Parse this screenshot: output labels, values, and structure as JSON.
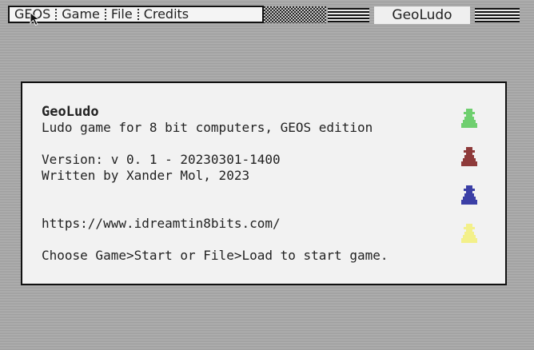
{
  "menu": {
    "items": [
      {
        "label": "GEOS"
      },
      {
        "label": "Game"
      },
      {
        "label": "File"
      },
      {
        "label": "Credits"
      }
    ]
  },
  "header": {
    "app_title": "GeoLudo"
  },
  "dialog": {
    "title": "GeoLudo",
    "subtitle": "Ludo game for 8 bit computers, GEOS edition",
    "version": "Version: v 0. 1 - 20230301-1400",
    "author": "Written by Xander Mol, 2023",
    "url": "https://www.idreamtin8bits.com/",
    "instructions": "Choose Game>Start or File>Load to start game."
  },
  "pawns": [
    {
      "name": "green",
      "color": "#6fcf6f"
    },
    {
      "name": "red",
      "color": "#8e3a3a"
    },
    {
      "name": "blue",
      "color": "#3b3fa6"
    },
    {
      "name": "yellow",
      "color": "#f3f08a"
    }
  ]
}
